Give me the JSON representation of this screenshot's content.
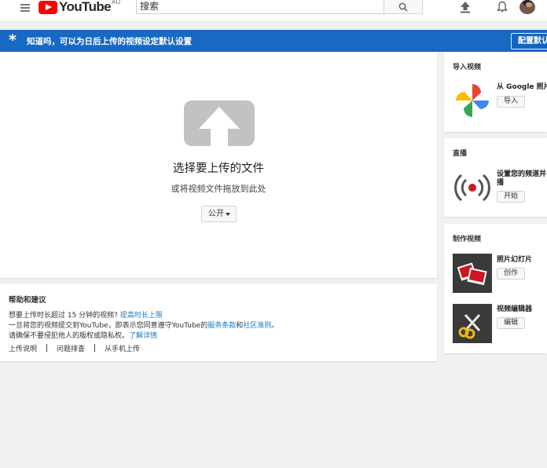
{
  "header": {
    "brand": "YouTube",
    "region": "AU",
    "search_placeholder": "搜索"
  },
  "banner": {
    "message": "知道吗，可以为日后上传的视频设定默认设置",
    "button": "配置默认"
  },
  "upload": {
    "title": "选择要上传的文件",
    "subtitle": "或将视频文件拖放到此处",
    "privacy_value": "公开"
  },
  "help": {
    "title": "帮助和建议",
    "line1_prefix": "想要上传时长超过 15 分钟的视频?",
    "line1_link": "提高时长上限",
    "line2_prefix": "一旦将您的视频提交到YouTube，即表示您同意遵守YouTube的",
    "line2_link1": "服务条款",
    "line2_mid": "和",
    "line2_link2": "社区准则",
    "line2_suffix": "。",
    "line3_prefix": "请确保不要侵犯他人的版权或隐私权。",
    "line3_link": "了解详情",
    "links": [
      "上传说明",
      "问题排查",
      "从手机上传"
    ]
  },
  "sidebar": {
    "import": {
      "title": "导入视频",
      "label": "从 Google 照片导",
      "button": "导入"
    },
    "live": {
      "title": "直播",
      "label_line1": "设置您的频道并",
      "label_line2": "播",
      "button": "开始"
    },
    "create": {
      "title": "制作视频",
      "slideshow_label": "照片幻灯片",
      "slideshow_button": "创作",
      "editor_label": "视频编辑器",
      "editor_button": "编辑"
    }
  },
  "colors": {
    "banner": "#1869c4",
    "link": "#167ac6",
    "logo_red": "#ff0000"
  }
}
